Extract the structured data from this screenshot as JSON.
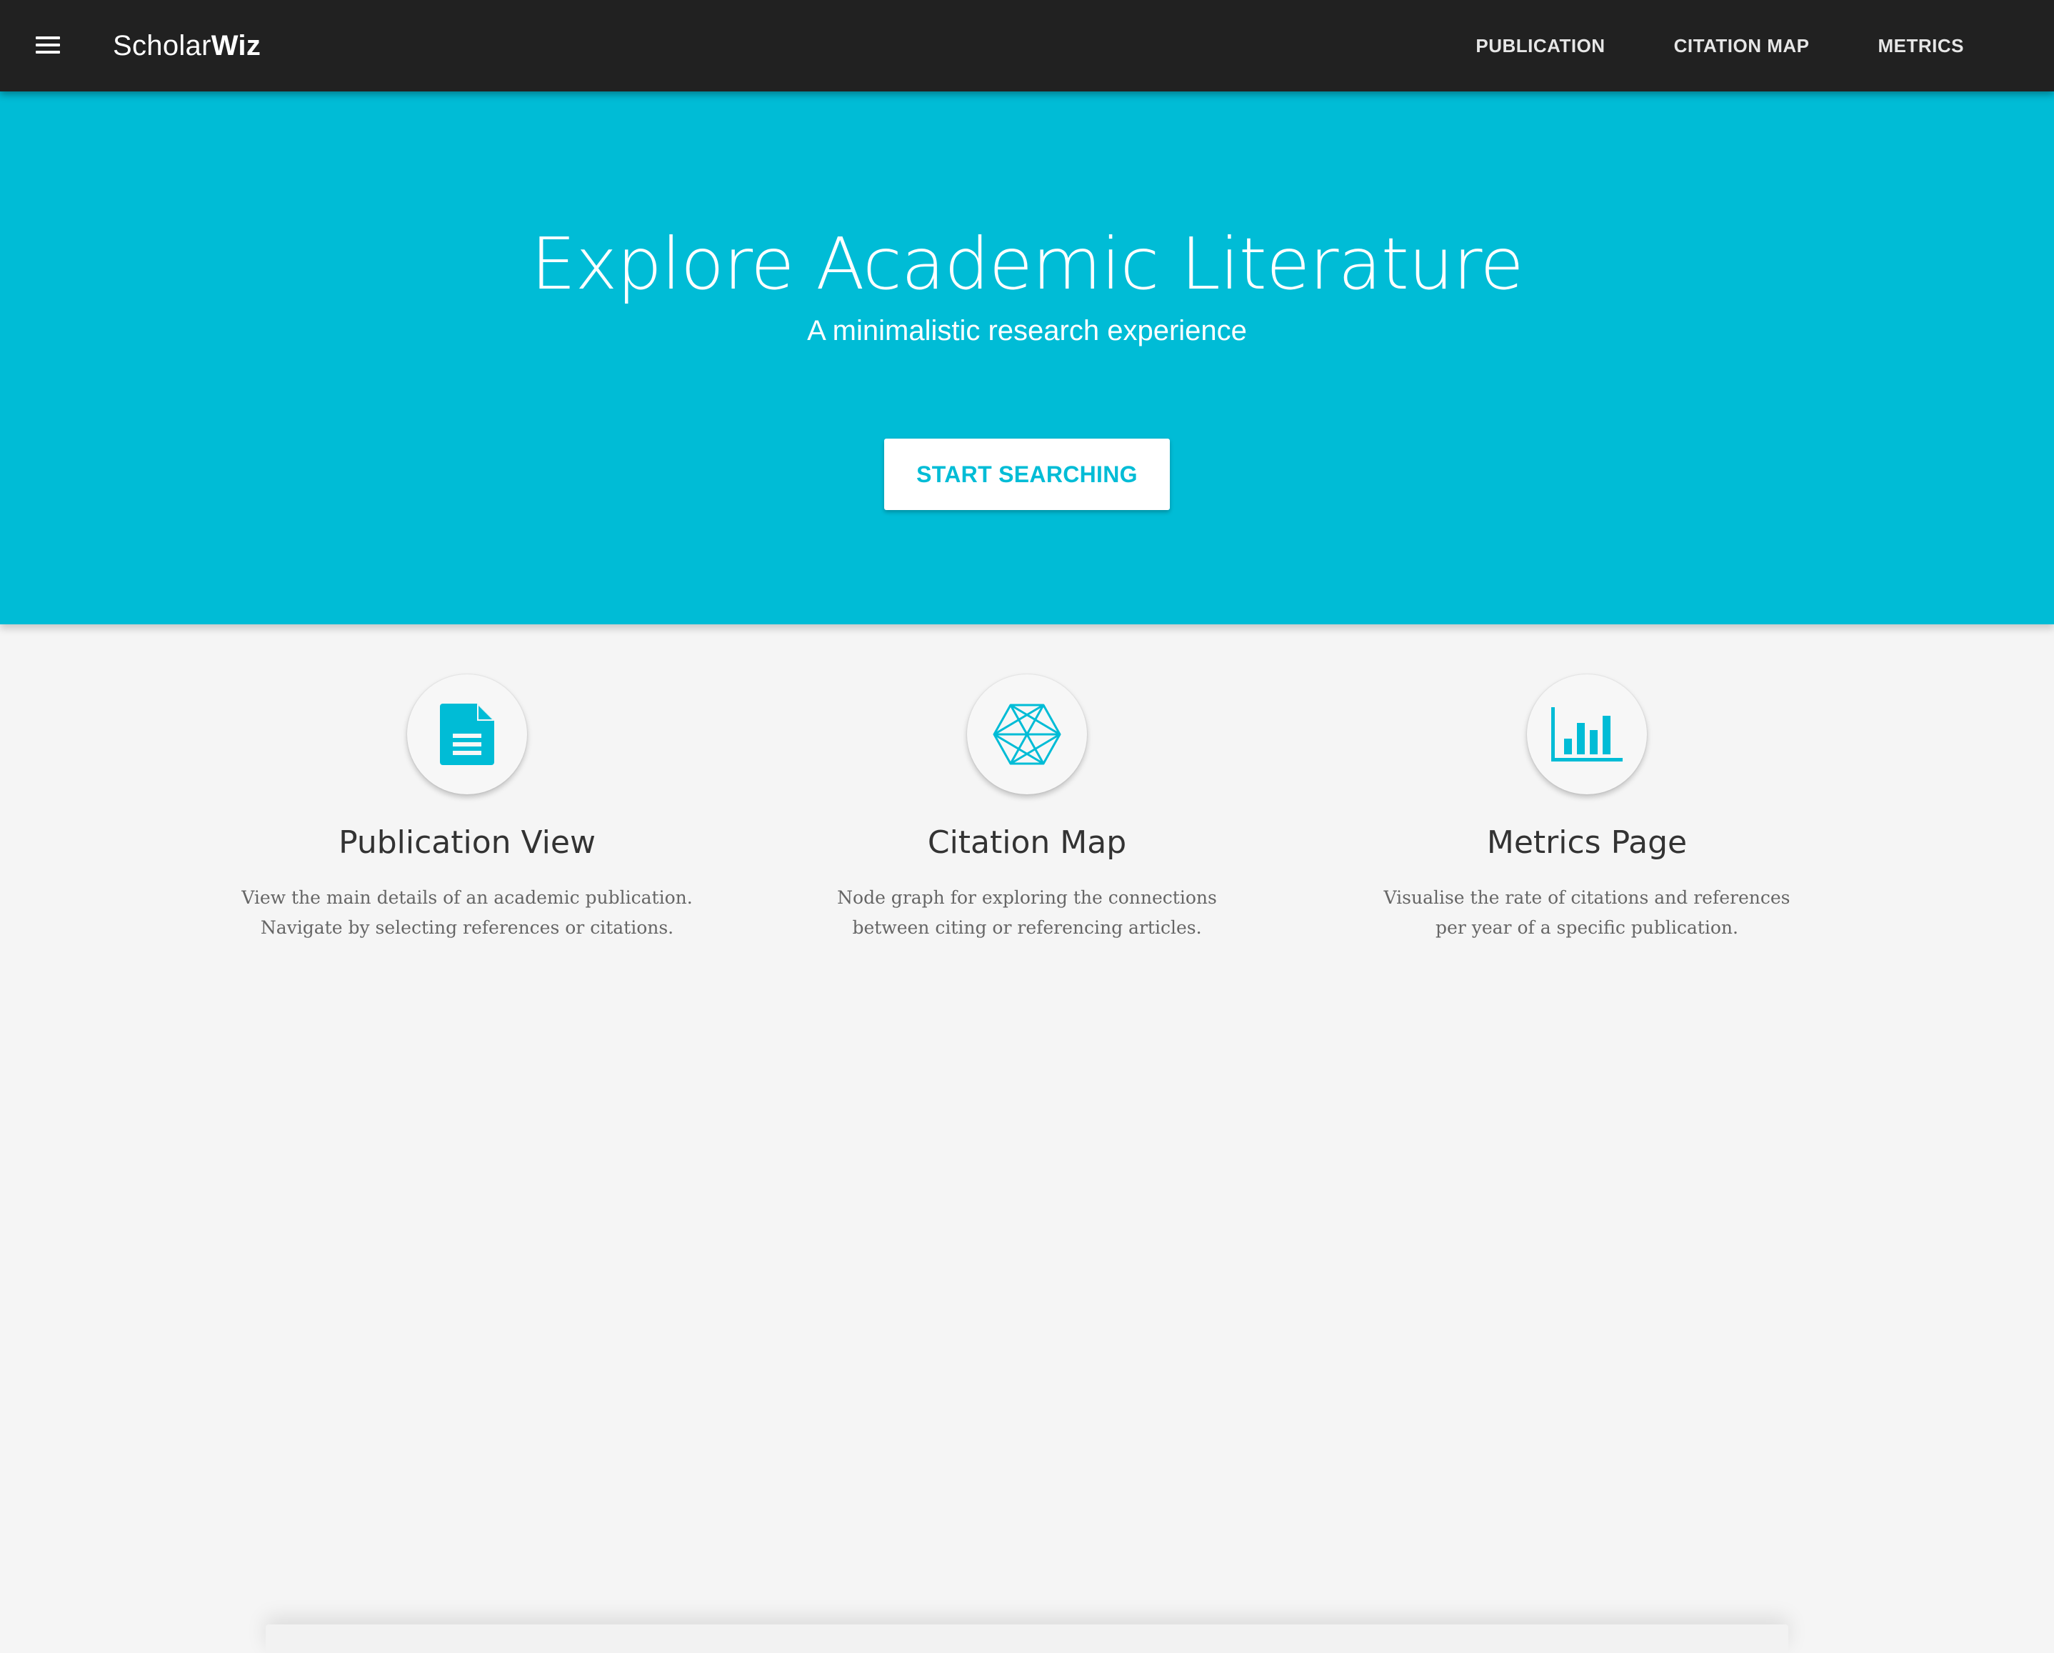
{
  "navbar": {
    "brand_regular": "Scholar",
    "brand_bold": "Wiz",
    "menu_icon": "hamburger-menu-icon",
    "links": [
      {
        "label": "PUBLICATION"
      },
      {
        "label": "CITATION MAP"
      },
      {
        "label": "METRICS"
      }
    ]
  },
  "hero": {
    "title": "Explore Academic Literature",
    "subtitle": "A minimalistic research experience",
    "cta_label": "START SEARCHING",
    "background_color": "#00bcd6"
  },
  "features": [
    {
      "icon": "document-icon",
      "title": "Publication View",
      "desc_line1": "View the main details of an academic publication.",
      "desc_line2": "Navigate by selecting references or citations."
    },
    {
      "icon": "network-graph-icon",
      "title": "Citation Map",
      "desc_line1": "Node graph for exploring the connections",
      "desc_line2": "between citing or referencing articles."
    },
    {
      "icon": "bar-chart-icon",
      "title": "Metrics Page",
      "desc_line1": "Visualise the rate of citations and references",
      "desc_line2": "per year of a specific publication."
    }
  ],
  "colors": {
    "accent": "#00bcd6",
    "navbar": "#212121",
    "page_background": "#f5f5f5"
  }
}
